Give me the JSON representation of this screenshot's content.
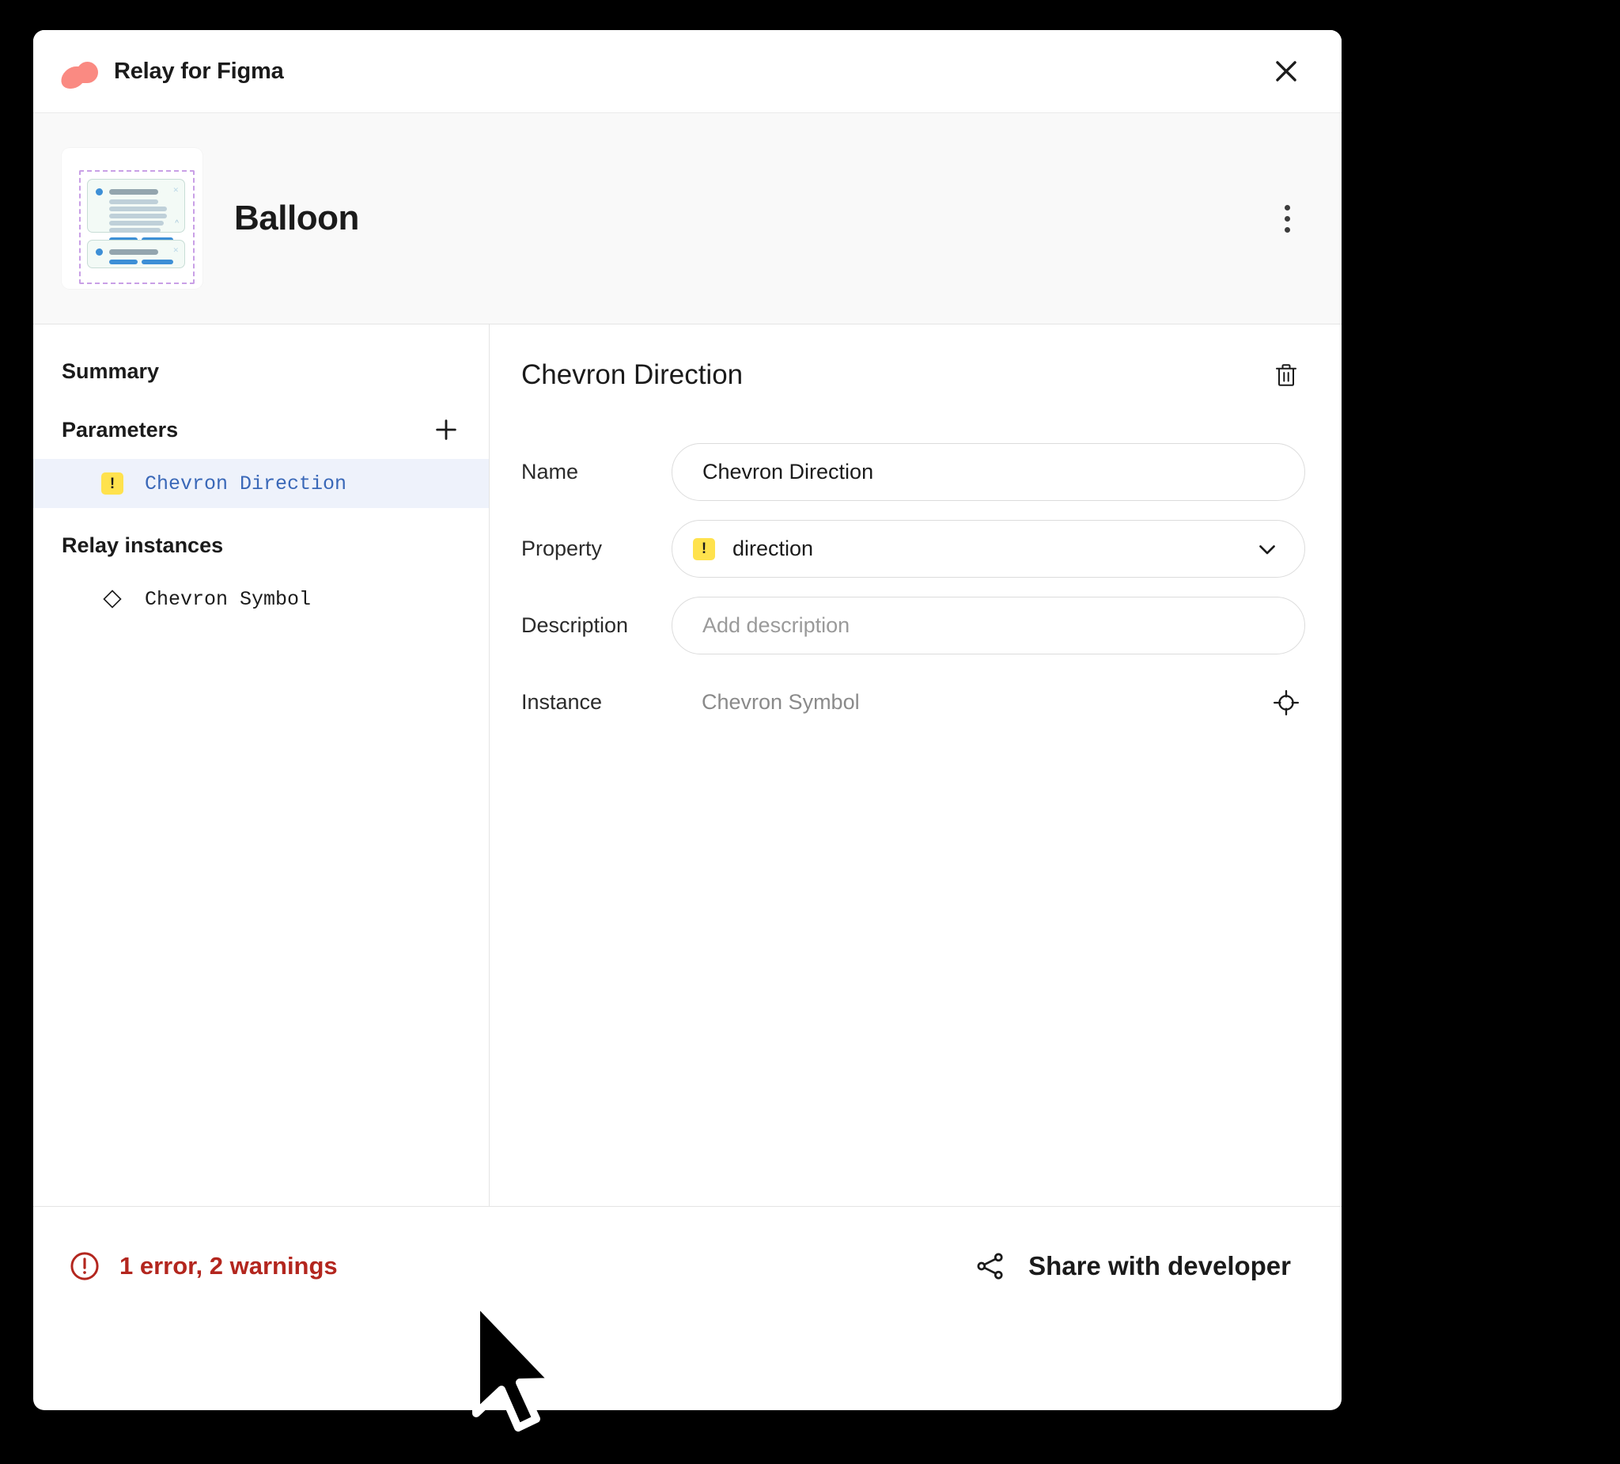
{
  "window": {
    "title": "Relay for Figma",
    "logo_color": "#FA8A82",
    "close_icon": "close-icon"
  },
  "document": {
    "name": "Balloon",
    "thumbnail_alt": "balloon-frame-thumbnail",
    "menu_icon": "kebab-menu-icon"
  },
  "sidebar": {
    "sections": [
      {
        "label": "Summary"
      },
      {
        "label": "Parameters",
        "action_icon": "plus-icon"
      },
      {
        "label": "Relay instances"
      }
    ],
    "parameters": [
      {
        "label": "Chevron Direction",
        "badge": "!",
        "badge_color": "#ffe24d",
        "selected": true
      }
    ],
    "instances": [
      {
        "label": "Chevron Symbol",
        "icon": "diamond-icon"
      }
    ]
  },
  "detail": {
    "title": "Chevron Direction",
    "delete_icon": "trash-icon",
    "fields": {
      "name_label": "Name",
      "name_value": "Chevron Direction",
      "property_label": "Property",
      "property_value": "direction",
      "property_badge": "!",
      "property_chevron": "chevron-down-icon",
      "description_label": "Description",
      "description_value": "",
      "description_placeholder": "Add description",
      "instance_label": "Instance",
      "instance_value": "Chevron Symbol",
      "instance_icon": "crosshair-target-icon"
    }
  },
  "footer": {
    "status_text": "1 error, 2 warnings",
    "status_color": "#b3261e",
    "status_icon": "alert-circle-icon",
    "share_label": "Share with developer",
    "share_icon": "share-network-icon"
  }
}
